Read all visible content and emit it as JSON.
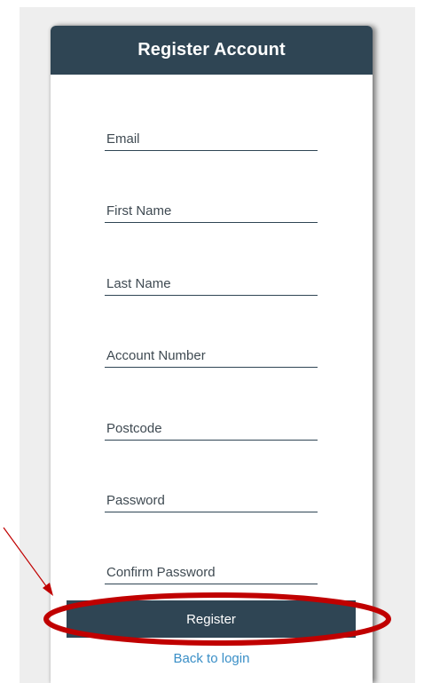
{
  "form": {
    "title": "Register Account",
    "fields": [
      {
        "placeholder": "Email",
        "value": ""
      },
      {
        "placeholder": "First Name",
        "value": ""
      },
      {
        "placeholder": "Last Name",
        "value": ""
      },
      {
        "placeholder": "Account Number",
        "value": ""
      },
      {
        "placeholder": "Postcode",
        "value": ""
      },
      {
        "placeholder": "Password",
        "value": ""
      },
      {
        "placeholder": "Confirm Password",
        "value": ""
      }
    ],
    "register_label": "Register",
    "back_link_label": "Back to login"
  },
  "colors": {
    "header_bg": "#2f4554",
    "button_bg": "#2f4554",
    "link": "#3a8fc7",
    "annotation": "#c00000"
  },
  "annotation": {
    "type": "arrow-and-ellipse",
    "target": "register-button"
  }
}
